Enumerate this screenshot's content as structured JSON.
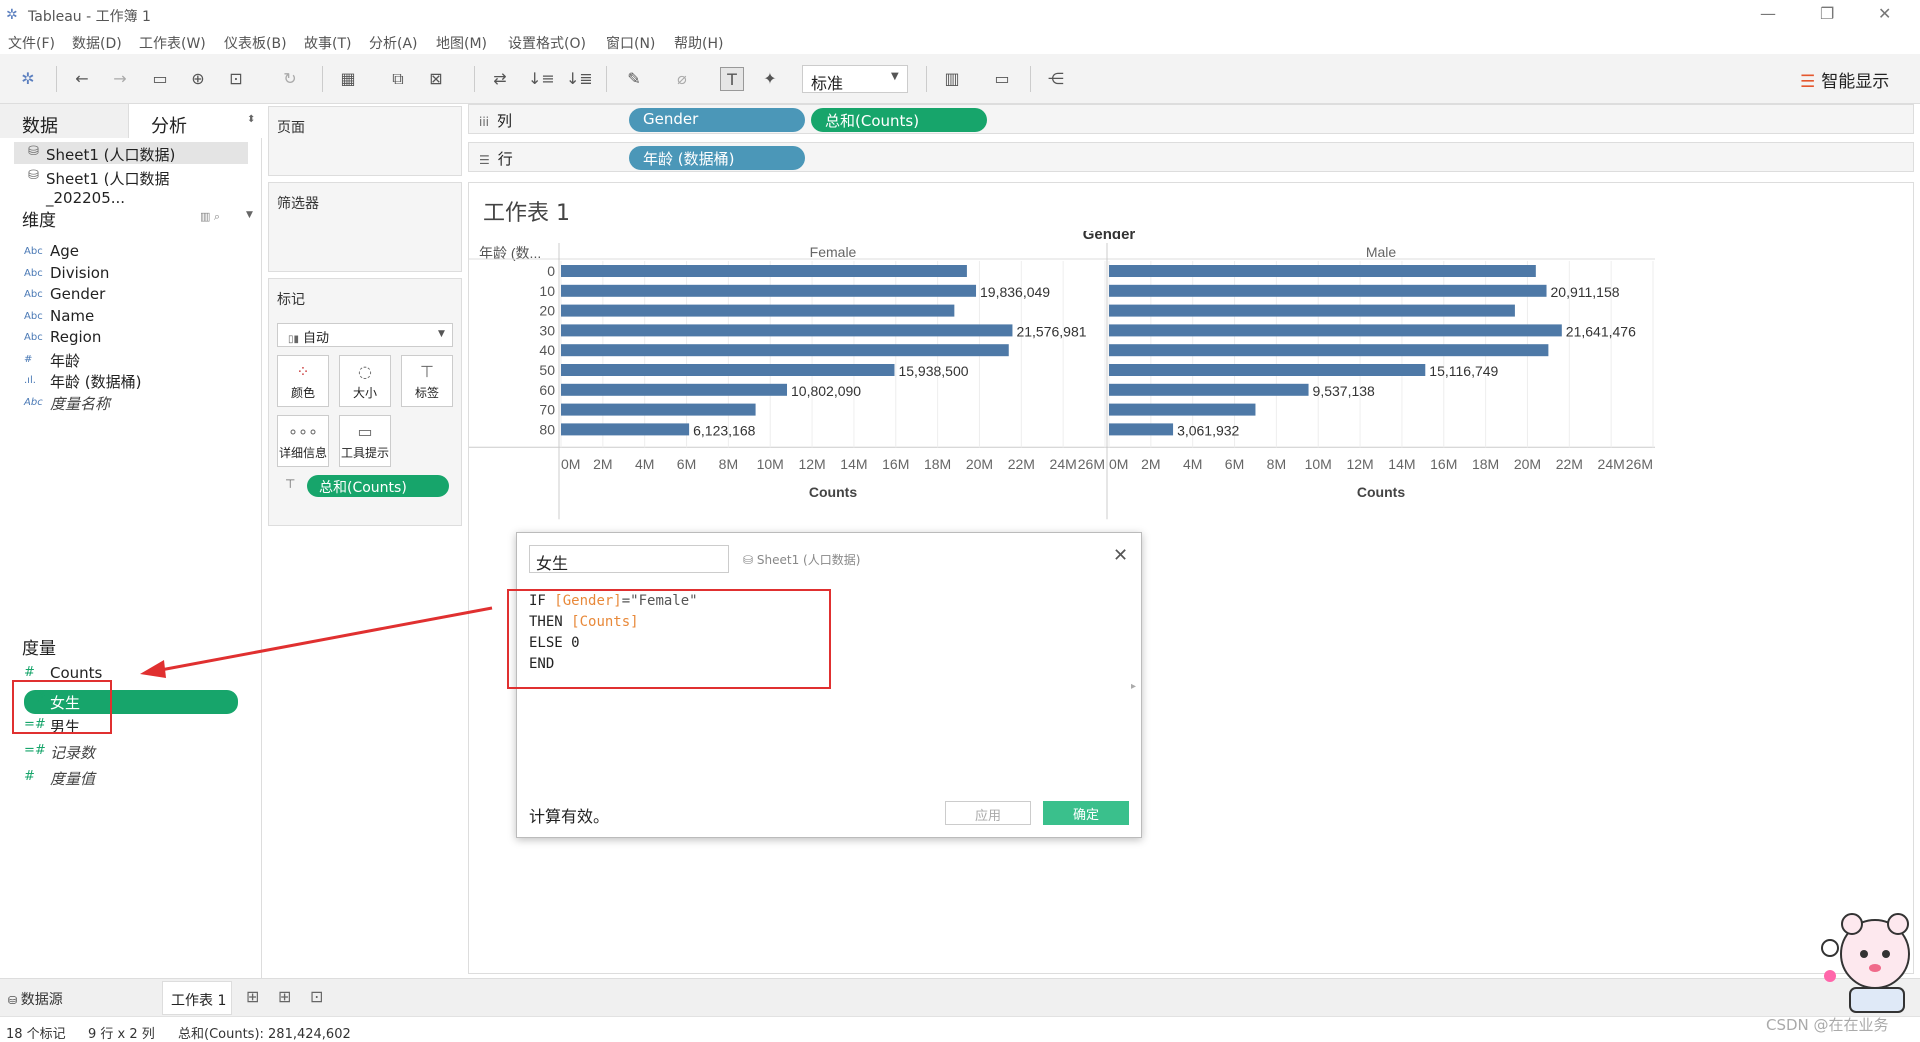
{
  "window": {
    "title": "Tableau - 工作簿 1",
    "controls": {
      "minimize": "—",
      "restore": "❐",
      "close": "✕"
    }
  },
  "menu": [
    "文件(F)",
    "数据(D)",
    "工作表(W)",
    "仪表板(B)",
    "故事(T)",
    "分析(A)",
    "地图(M)",
    "设置格式(O)",
    "窗口(N)",
    "帮助(H)"
  ],
  "toolbar": {
    "view_select": "标准",
    "show_me": "智能显示"
  },
  "left_panel": {
    "tabs": {
      "data": "数据",
      "analysis": "分析"
    },
    "datasources": [
      "Sheet1 (人口数据)",
      "Sheet1 (人口数据_202205..."
    ],
    "dimensions_title": "维度",
    "dimensions": [
      {
        "icon": "Abc",
        "name": "Age",
        "italic": false
      },
      {
        "icon": "Abc",
        "name": "Division",
        "italic": false
      },
      {
        "icon": "Abc",
        "name": "Gender",
        "italic": false
      },
      {
        "icon": "Abc",
        "name": "Name",
        "italic": false
      },
      {
        "icon": "Abc",
        "name": "Region",
        "italic": false
      },
      {
        "icon": "#",
        "name": "年龄",
        "italic": false
      },
      {
        "icon": ".ıl.",
        "name": "年龄 (数据桶)",
        "italic": false
      },
      {
        "icon": "Abc",
        "name": "度量名称",
        "italic": true
      }
    ],
    "measures_title": "度量",
    "measures": [
      {
        "icon": "#",
        "name": "Counts",
        "italic": false,
        "selected": false
      },
      {
        "icon": "=#",
        "name": "女生",
        "italic": false,
        "selected": true
      },
      {
        "icon": "=#",
        "name": "男生",
        "italic": false,
        "selected": false
      },
      {
        "icon": "=#",
        "name": "记录数",
        "italic": true,
        "selected": false
      },
      {
        "icon": "#",
        "name": "度量值",
        "italic": true,
        "selected": false
      }
    ]
  },
  "cards": {
    "pages": "页面",
    "filters": "筛选器",
    "marks": "标记",
    "mark_type": "自动",
    "mark_buttons": [
      "颜色",
      "大小",
      "标签",
      "详细信息",
      "工具提示"
    ],
    "mark_pill": "总和(Counts)"
  },
  "shelves": {
    "columns_label": "列",
    "rows_label": "行",
    "columns": [
      "Gender",
      "总和(Counts)"
    ],
    "rows": [
      "年龄 (数据桶)"
    ]
  },
  "sheet_title": "工作表 1",
  "chart_data": {
    "type": "bar",
    "orientation": "horizontal",
    "title": "Gender",
    "row_header": "年龄 (数...",
    "categories": [
      "0",
      "10",
      "20",
      "30",
      "40",
      "50",
      "60",
      "70",
      "80"
    ],
    "xlabel": "Counts",
    "xlim": [
      0,
      26000000
    ],
    "x_ticks": [
      "0M",
      "2M",
      "4M",
      "6M",
      "8M",
      "10M",
      "12M",
      "14M",
      "16M",
      "18M",
      "20M",
      "22M",
      "24M",
      "26M"
    ],
    "panels": [
      {
        "name": "Female",
        "values": [
          19400000,
          19836049,
          18800000,
          21576981,
          21400000,
          15938500,
          10802090,
          9300000,
          6123168
        ],
        "labels": [
          "",
          "19,836,049",
          "",
          "21,576,981",
          "",
          "15,938,500",
          "10,802,090",
          "",
          "6,123,168"
        ]
      },
      {
        "name": "Male",
        "values": [
          20400000,
          20911158,
          19400000,
          21641476,
          21000000,
          15116749,
          9537138,
          7000000,
          3061932
        ],
        "labels": [
          "",
          "20,911,158",
          "",
          "21,641,476",
          "",
          "15,116,749",
          "9,537,138",
          "",
          "3,061,932"
        ]
      }
    ],
    "bar_color": "#4e79a7",
    "grid": true
  },
  "calc_dialog": {
    "name": "女生",
    "source": "Sheet1 (人口数据)",
    "formula": [
      [
        [
          "kw",
          "IF "
        ],
        [
          "fld",
          "[Gender]"
        ],
        [
          "str",
          "=\"Female\""
        ]
      ],
      [
        [
          "kw",
          "THEN "
        ],
        [
          "fld",
          "[Counts]"
        ]
      ],
      [
        [
          "kw",
          "ELSE 0"
        ]
      ],
      [
        [
          "kw",
          "END"
        ]
      ]
    ],
    "status": "计算有效。",
    "apply_label": "应用",
    "ok_label": "确定"
  },
  "bottom": {
    "datasource_tab": "数据源",
    "sheet_tab": "工作表 1"
  },
  "status": {
    "marks": "18 个标记",
    "dims": "9 行 x 2 列",
    "sum": "总和(Counts): 281,424,602"
  },
  "watermark": "CSDN @在在业务"
}
